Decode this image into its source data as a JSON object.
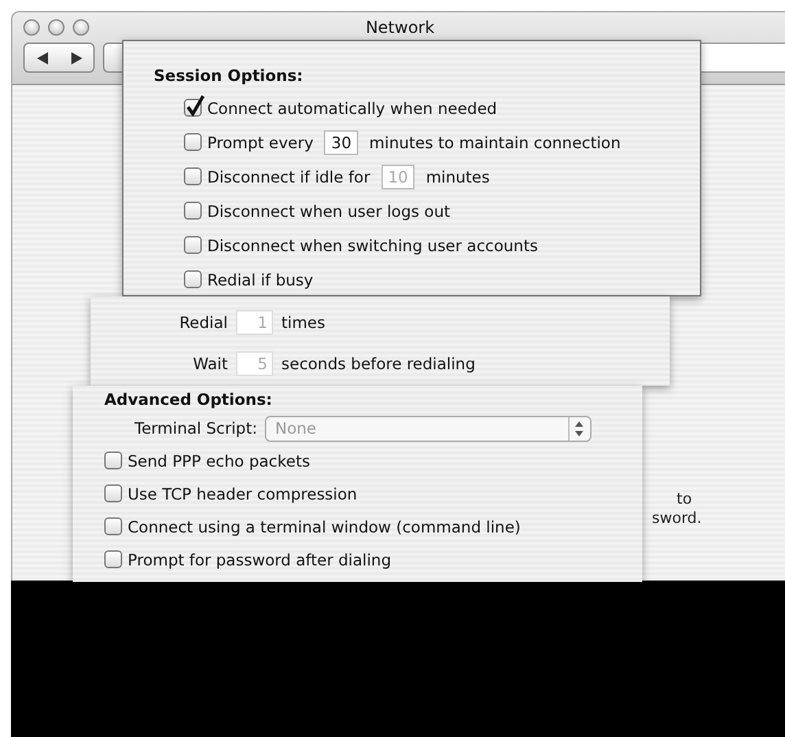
{
  "window": {
    "title": "Network"
  },
  "session_options": {
    "heading": "Session Options:",
    "options": [
      {
        "kind": "plain",
        "label": "Connect automatically when needed",
        "checked": true
      },
      {
        "kind": "field",
        "before": "Prompt every",
        "value": "30",
        "after": "minutes to maintain connection",
        "checked": false,
        "disabled": false
      },
      {
        "kind": "field",
        "before": "Disconnect if idle for",
        "value": "10",
        "after": "minutes",
        "checked": false,
        "disabled": true
      },
      {
        "kind": "plain",
        "label": "Disconnect when user logs out",
        "checked": false
      },
      {
        "kind": "plain",
        "label": "Disconnect when switching user accounts",
        "checked": false
      },
      {
        "kind": "plain",
        "label": "Redial if busy",
        "checked": false
      }
    ]
  },
  "redial": [
    {
      "label": "Redial",
      "value": "1",
      "unit": "times",
      "disabled": true
    },
    {
      "label": "Wait",
      "value": "5",
      "unit": "seconds before redialing",
      "disabled": true
    }
  ],
  "advanced_options": {
    "heading": "Advanced Options:",
    "terminal_script": {
      "label": "Terminal Script:",
      "value": "None",
      "disabled": true
    },
    "options": [
      {
        "label": "Send PPP echo packets",
        "checked": false
      },
      {
        "label": "Use TCP header compression",
        "checked": false
      },
      {
        "label": "Connect using a terminal window (command line)",
        "checked": false
      },
      {
        "label": "Prompt for password after dialing",
        "checked": false
      }
    ]
  },
  "background_text": [
    "to",
    "sword."
  ]
}
